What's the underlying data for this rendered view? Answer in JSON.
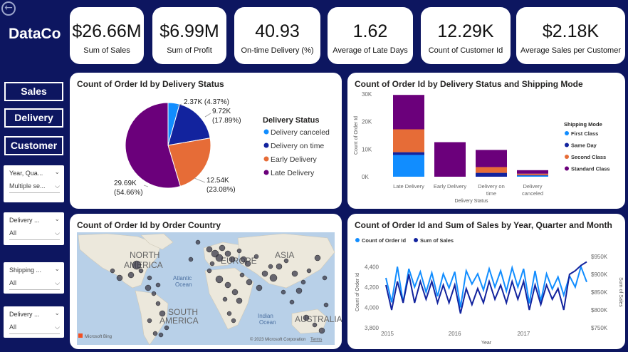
{
  "app": {
    "logo": "DataCo"
  },
  "kpis": [
    {
      "value": "$26.66M",
      "label": "Sum of Sales"
    },
    {
      "value": "$6.99M",
      "label": "Sum of Profit"
    },
    {
      "value": "40.93",
      "label": "On-time Delivery (%)"
    },
    {
      "value": "1.62",
      "label": "Average of Late Days"
    },
    {
      "value": "12.29K",
      "label": "Count of Customer Id"
    },
    {
      "value": "$2.18K",
      "label": "Average Sales per Customer"
    }
  ],
  "nav": {
    "sales": "Sales",
    "delivery": "Delivery",
    "customer": "Customer"
  },
  "slicers": [
    {
      "title": "Year, Qua...",
      "value": "Multiple se..."
    },
    {
      "title": "Delivery ...",
      "value": "All"
    },
    {
      "title": "Shipping ...",
      "value": "All"
    },
    {
      "title": "Delivery ...",
      "value": "All"
    }
  ],
  "panels": {
    "pie_title": "Count of Order Id by Delivery Status",
    "stack_title": "Count of Order Id by Delivery Status and Shipping Mode",
    "map_title": "Count of Order Id by Order Country",
    "line_title": "Count of Order Id and Sum of Sales by Year, Quarter and Month"
  },
  "map": {
    "labels": {
      "north_america_1": "NORTH",
      "north_america_2": "AMERICA",
      "europe": "EUROPE",
      "asia": "ASIA",
      "south_america_1": "SOUTH",
      "south_america_2": "AMERICA",
      "australia": "AUSTRALIA",
      "atlantic_1": "Atlantic",
      "atlantic_2": "Ocean",
      "indian_1": "Indian",
      "indian_2": "Ocean"
    },
    "bing": "Microsoft Bing",
    "copyright": "© 2023 Microsoft Corporation",
    "terms": "Terms"
  },
  "chart_data": [
    {
      "type": "pie",
      "title": "Count of Order Id by Delivery Status",
      "legend_title": "Delivery Status",
      "legend_position": "right",
      "slices": [
        {
          "name": "Delivery canceled",
          "value": 2.37,
          "value_label": "2.37K (4.37%)",
          "line1": "2.37K (4.37%)",
          "line2": "",
          "color": "#118dff"
        },
        {
          "name": "Delivery on time",
          "value": 9.72,
          "value_label": "9.72K (17.89%)",
          "line1": "9.72K",
          "line2": "(17.89%)",
          "color": "#12239e"
        },
        {
          "name": "Early Delivery",
          "value": 12.54,
          "value_label": "12.54K (23.08%)",
          "line1": "12.54K",
          "line2": "(23.08%)",
          "color": "#e66c37"
        },
        {
          "name": "Late Delivery",
          "value": 29.69,
          "value_label": "29.69K (54.66%)",
          "line1": "29.69K",
          "line2": "(54.66%)",
          "color": "#6b007b"
        }
      ]
    },
    {
      "type": "bar",
      "stacked": true,
      "title": "Count of Order Id by Delivery Status and Shipping Mode",
      "xlabel": "Delivery Status",
      "ylabel": "Count of Order Id",
      "ylim": [
        0,
        30000
      ],
      "yticks": [
        "0K",
        "10K",
        "20K",
        "30K"
      ],
      "legend_title": "Shipping Mode",
      "categories": [
        [
          "Late Delivery"
        ],
        [
          "Early Delivery"
        ],
        [
          "Delivery on",
          "time"
        ],
        [
          "Delivery",
          "canceled"
        ]
      ],
      "series": [
        {
          "name": "First Class",
          "color": "#118dff",
          "values": [
            7900,
            0,
            0,
            400
          ]
        },
        {
          "name": "Same Day",
          "color": "#12239e",
          "values": [
            1000,
            0,
            1400,
            200
          ]
        },
        {
          "name": "Second Class",
          "color": "#e66c37",
          "values": [
            8300,
            0,
            2100,
            500
          ]
        },
        {
          "name": "Standard Class",
          "color": "#6b007b",
          "values": [
            12490,
            12540,
            6220,
            1270
          ]
        }
      ]
    },
    {
      "type": "scatter",
      "title": "Count of Order Id by Order Country"
    },
    {
      "type": "line",
      "title": "Count of Order Id and Sum of Sales by Year, Quarter and Month",
      "xlabel": "Year",
      "ylabel": "Count of Order Id",
      "ylabel2": "Sum of Sales",
      "ylim": [
        3800,
        4500
      ],
      "ylim2": [
        750,
        950
      ],
      "yticks": [
        "3,800",
        "4,000",
        "4,200",
        "4,400"
      ],
      "yticks2": [
        "$750K",
        "$800K",
        "$850K",
        "$900K",
        "$950K"
      ],
      "xticks": [
        "2015",
        "2016",
        "2017"
      ],
      "legend_position": "top-left",
      "series": [
        {
          "name": "Count of Order Id",
          "color": "#118dff",
          "values": [
            4290,
            4050,
            4400,
            4050,
            4380,
            4200,
            4350,
            4150,
            4340,
            4110,
            4330,
            4190,
            4350,
            4000,
            4360,
            4230,
            4330,
            4170,
            4380,
            4200,
            4360,
            4160,
            4390,
            4200,
            4380,
            4040,
            4360,
            4060,
            4330,
            4180,
            4300,
            4120,
            4310,
            4200,
            4400,
            4250
          ]
        },
        {
          "name": "Sum of Sales",
          "color": "#12239e",
          "values": [
            870,
            800,
            880,
            820,
            900,
            820,
            880,
            830,
            880,
            820,
            870,
            820,
            870,
            790,
            860,
            815,
            860,
            820,
            880,
            830,
            870,
            820,
            880,
            830,
            880,
            800,
            870,
            815,
            870,
            830,
            860,
            800,
            900,
            910,
            925,
            935
          ]
        }
      ]
    }
  ]
}
